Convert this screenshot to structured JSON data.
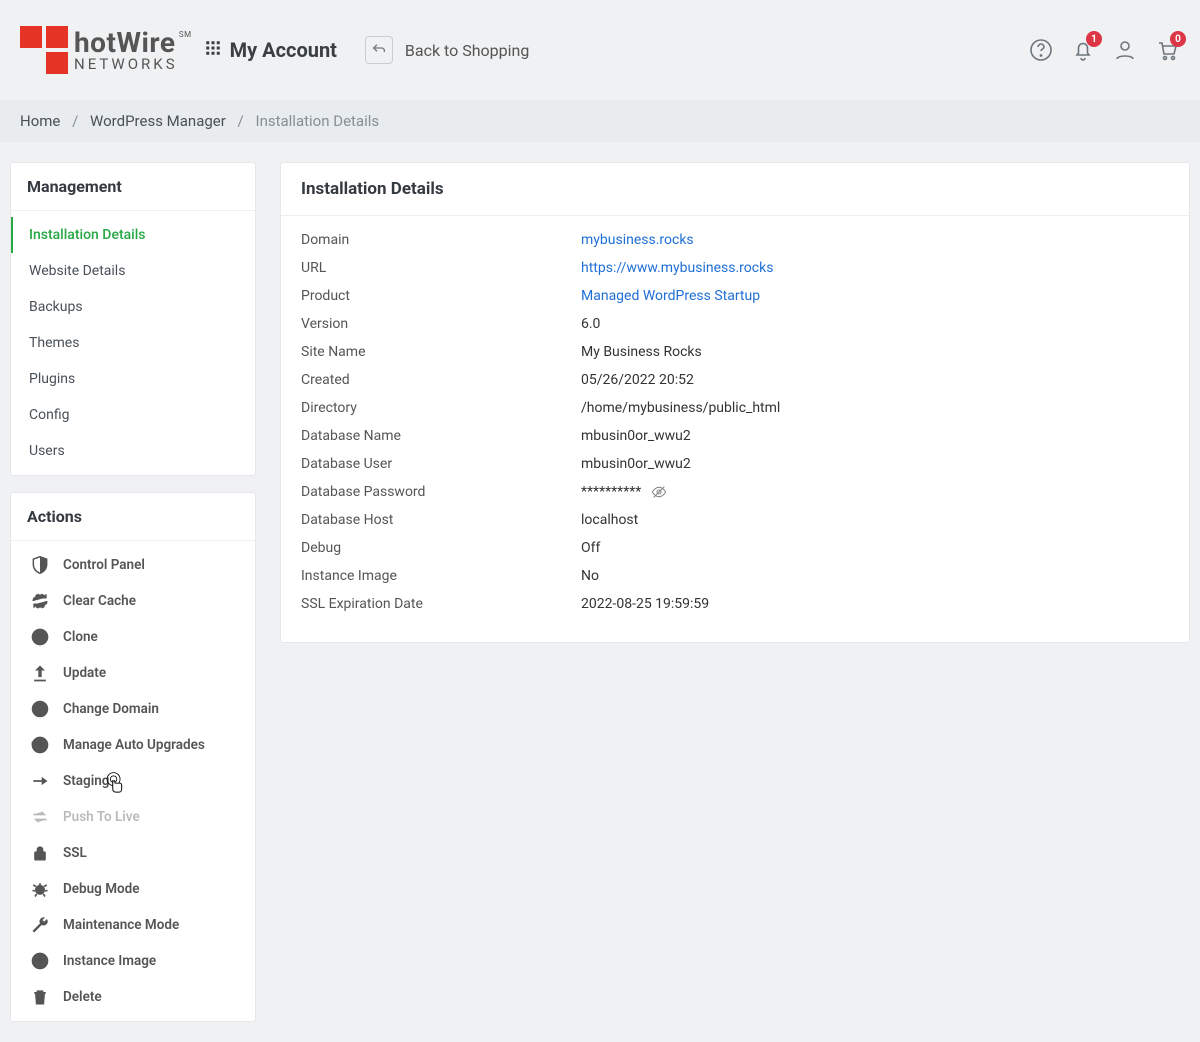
{
  "header": {
    "logo_top": "hotWire",
    "logo_sm": "SM",
    "logo_bottom": "NETWORKS",
    "account_label": "My Account",
    "return_label": "Back to Shopping",
    "notif_count": "1",
    "cart_count": "0"
  },
  "breadcrumb": {
    "home": "Home",
    "level1": "WordPress Manager",
    "current": "Installation Details"
  },
  "management": {
    "title": "Management",
    "items": [
      "Installation Details",
      "Website Details",
      "Backups",
      "Themes",
      "Plugins",
      "Config",
      "Users"
    ]
  },
  "actions": {
    "title": "Actions",
    "items": [
      "Control Panel",
      "Clear Cache",
      "Clone",
      "Update",
      "Change Domain",
      "Manage Auto Upgrades",
      "Staging",
      "Push To Live",
      "SSL",
      "Debug Mode",
      "Maintenance Mode",
      "Instance Image",
      "Delete"
    ]
  },
  "details": {
    "title": "Installation Details",
    "rows": {
      "domain_l": "Domain",
      "domain_v": "mybusiness.rocks",
      "url_l": "URL",
      "url_v": "https://www.mybusiness.rocks",
      "product_l": "Product",
      "product_v": "Managed WordPress Startup",
      "version_l": "Version",
      "version_v": "6.0",
      "sitename_l": "Site Name",
      "sitename_v": "My Business Rocks",
      "created_l": "Created",
      "created_v": "05/26/2022 20:52",
      "directory_l": "Directory",
      "directory_v": "/home/mybusiness/public_html",
      "dbname_l": "Database Name",
      "dbname_v": "mbusin0or_wwu2",
      "dbuser_l": "Database User",
      "dbuser_v": "mbusin0or_wwu2",
      "dbpass_l": "Database Password",
      "dbpass_v": "**********",
      "dbhost_l": "Database Host",
      "dbhost_v": "localhost",
      "debug_l": "Debug",
      "debug_v": "Off",
      "instimg_l": "Instance Image",
      "instimg_v": "No",
      "sslexp_l": "SSL Expiration Date",
      "sslexp_v": "2022-08-25 19:59:59"
    }
  }
}
